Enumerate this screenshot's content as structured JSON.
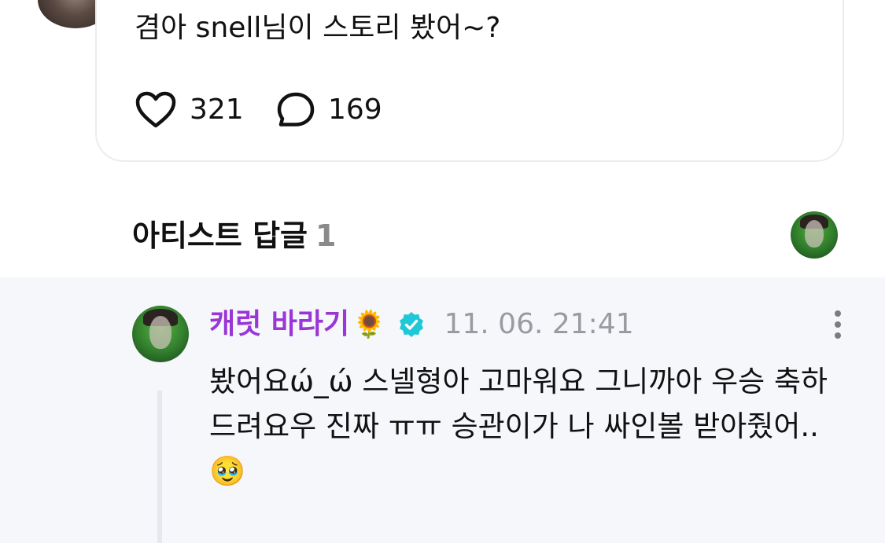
{
  "post": {
    "text": "겸아 snell님이 스토리 봤어~?",
    "likes": "321",
    "comments": "169",
    "icons": {
      "like": "heart-outline-icon",
      "comment": "speech-bubble-icon"
    }
  },
  "artist_replies": {
    "title": "아티스트 답글",
    "count": "1"
  },
  "reply": {
    "author": "캐럿 바라기",
    "author_emoji": "🌻",
    "timestamp": "11. 06. 21:41",
    "text": "봤어요ώ_ώ 스넬형아 고마워요 그니까아 우승 축하드려요우 진짜 ㅠㅠ 승관이가 나 싸인볼 받아줬어..🥹",
    "icons": {
      "verified": "verified-badge-icon",
      "more": "more-vertical-icon"
    }
  },
  "colors": {
    "author_name": "#9a35d6",
    "verified_badge": "#1ec8d8",
    "reply_bg": "#f6f7fb",
    "muted_text": "#9a9aa0"
  }
}
